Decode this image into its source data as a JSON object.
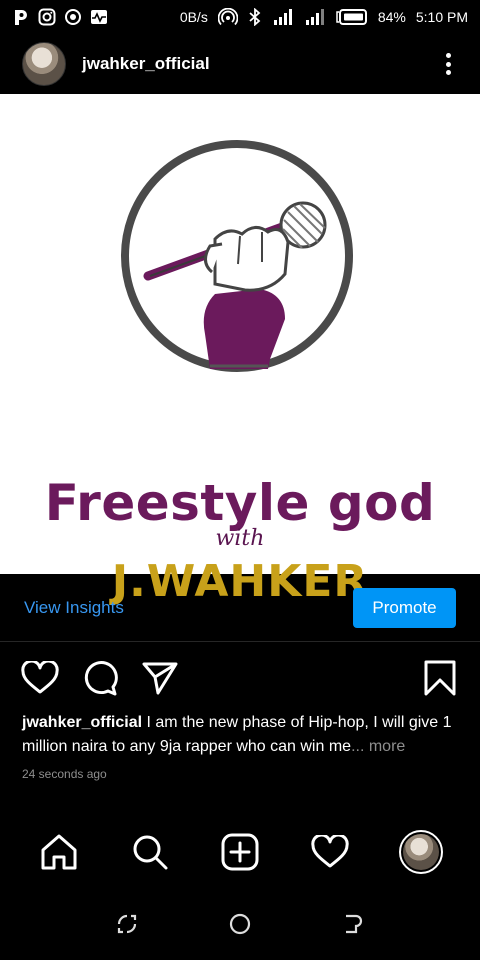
{
  "status_bar": {
    "network_speed": "0B/s",
    "battery": "84%",
    "time": "5:10 PM",
    "icons_left": [
      "p-app-icon",
      "instagram-icon",
      "circle-app-icon",
      "pulse-app-icon"
    ],
    "icons_right": [
      "hotspot-icon",
      "bluetooth-icon",
      "signal-icon",
      "signal-icon-2",
      "battery-icon"
    ]
  },
  "post": {
    "username": "jwahker_official",
    "image": {
      "title": "Freestyle god",
      "subtitle": "with",
      "artist": "J.WAHKER",
      "colors": {
        "purple": "#6b1a5c",
        "gold": "#c8a11a",
        "ring": "#444444"
      }
    },
    "insights_label": "View Insights",
    "promote_label": "Promote",
    "caption_user": "jwahker_official",
    "caption_text": " I am the new phase of Hip-hop, I will give 1 million naira to any 9ja rapper who can win me",
    "caption_ellipsis": "...",
    "caption_more": " more",
    "timestamp": "24 seconds ago"
  },
  "actions": [
    "heart-icon",
    "comment-icon",
    "share-icon",
    "bookmark-icon"
  ],
  "bottom_nav": [
    "home-icon",
    "search-icon",
    "add-post-icon",
    "activity-heart-icon",
    "profile-avatar"
  ],
  "system_nav": [
    "recents-icon",
    "home-circle-icon",
    "back-icon"
  ],
  "theme": {
    "background": "#000000",
    "link": "#3897f0",
    "button": "#0095f6",
    "muted": "#8e8e8e"
  }
}
